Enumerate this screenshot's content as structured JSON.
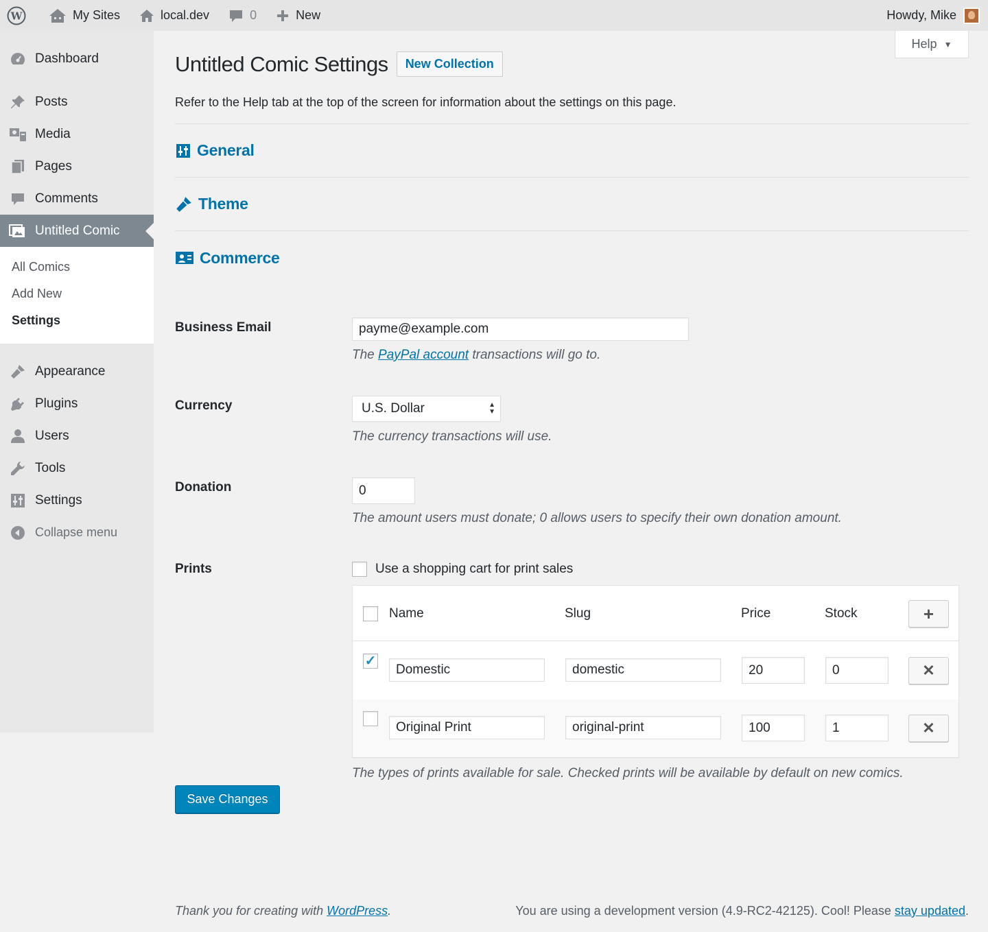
{
  "adminbar": {
    "wp_icon": "wordpress-logo-icon",
    "my_sites": "My Sites",
    "site_name": "local.dev",
    "comments_count": "0",
    "new_label": "New",
    "howdy": "Howdy, Mike"
  },
  "sidebar": {
    "items": [
      {
        "label": "Dashboard",
        "icon": "dashboard-icon"
      },
      {
        "label": "Posts",
        "icon": "pin-icon"
      },
      {
        "label": "Media",
        "icon": "media-icon"
      },
      {
        "label": "Pages",
        "icon": "pages-icon"
      },
      {
        "label": "Comments",
        "icon": "comments-icon"
      },
      {
        "label": "Untitled Comic",
        "icon": "comic-icon"
      },
      {
        "label": "Appearance",
        "icon": "appearance-icon"
      },
      {
        "label": "Plugins",
        "icon": "plugins-icon"
      },
      {
        "label": "Users",
        "icon": "users-icon"
      },
      {
        "label": "Tools",
        "icon": "tools-icon"
      },
      {
        "label": "Settings",
        "icon": "settings-icon"
      }
    ],
    "submenu": [
      "All Comics",
      "Add New",
      "Settings"
    ],
    "collapse": "Collapse menu"
  },
  "page": {
    "help": "Help",
    "title": "Untitled Comic Settings",
    "new_collection": "New Collection",
    "intro": "Refer to the Help tab at the top of the screen for information about the settings on this page.",
    "sections": {
      "general": "General",
      "theme": "Theme",
      "commerce": "Commerce"
    }
  },
  "form": {
    "business_email": {
      "label": "Business Email",
      "value": "payme@example.com",
      "desc_pre": "The ",
      "desc_link": "PayPal account",
      "desc_post": " transactions will go to."
    },
    "currency": {
      "label": "Currency",
      "value": "U.S. Dollar",
      "desc": "The currency transactions will use."
    },
    "donation": {
      "label": "Donation",
      "value": "0",
      "desc": "The amount users must donate; 0 allows users to specify their own donation amount."
    },
    "prints": {
      "label": "Prints",
      "cart_label": "Use a shopping cart for print sales",
      "cart_checked": false,
      "columns": [
        "Name",
        "Slug",
        "Price",
        "Stock"
      ],
      "rows": [
        {
          "checked": true,
          "name": "Domestic",
          "slug": "domestic",
          "price": "20",
          "stock": "0"
        },
        {
          "checked": false,
          "name": "Original Print",
          "slug": "original-print",
          "price": "100",
          "stock": "1"
        }
      ],
      "desc": "The types of prints available for sale. Checked prints will be available by default on new comics."
    },
    "save": "Save Changes"
  },
  "footer": {
    "left_pre": "Thank you for creating with ",
    "left_link": "WordPress",
    "left_post": ".",
    "right_pre": "You are using a development version (4.9-RC2-42125). Cool! Please ",
    "right_link": "stay updated",
    "right_post": "."
  },
  "colors": {
    "link": "#0073aa",
    "primary_button": "#0085ba",
    "active_menu": "#7e8891",
    "checkmark": "#1e8cbe"
  }
}
